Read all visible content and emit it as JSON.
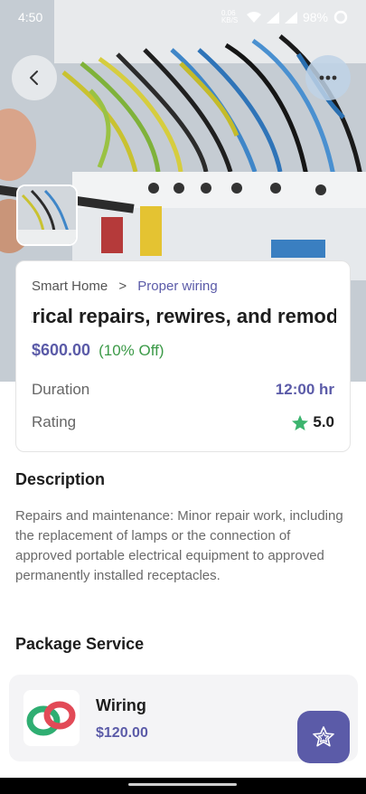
{
  "status_bar": {
    "time": "4:50",
    "network_speed": "0.06 KB/S",
    "battery": "98%"
  },
  "hero": {
    "back_icon": "chevron-left-icon",
    "more_icon": "more-horizontal-icon"
  },
  "card": {
    "breadcrumb": {
      "parent": "Smart Home",
      "separator": ">",
      "current": "Proper wiring"
    },
    "title": "Electrical repairs, rewires, and remodels",
    "price": "$600.00",
    "discount": "(10% Off)",
    "duration_label": "Duration",
    "duration_value": "12:00 hr",
    "rating_label": "Rating",
    "rating_value": "5.0"
  },
  "description": {
    "heading": "Description",
    "text": "Repairs and maintenance: Minor repair work, including the replacement of lamps or the connection of approved portable electrical equipment to approved permanently installed receptacles."
  },
  "package": {
    "heading": "Package Service",
    "items": [
      {
        "name": "Wiring",
        "price": "$120.00"
      }
    ]
  },
  "colors": {
    "accent": "#5b5ba8",
    "discount": "#3c9a48",
    "star": "#3cb46e"
  }
}
